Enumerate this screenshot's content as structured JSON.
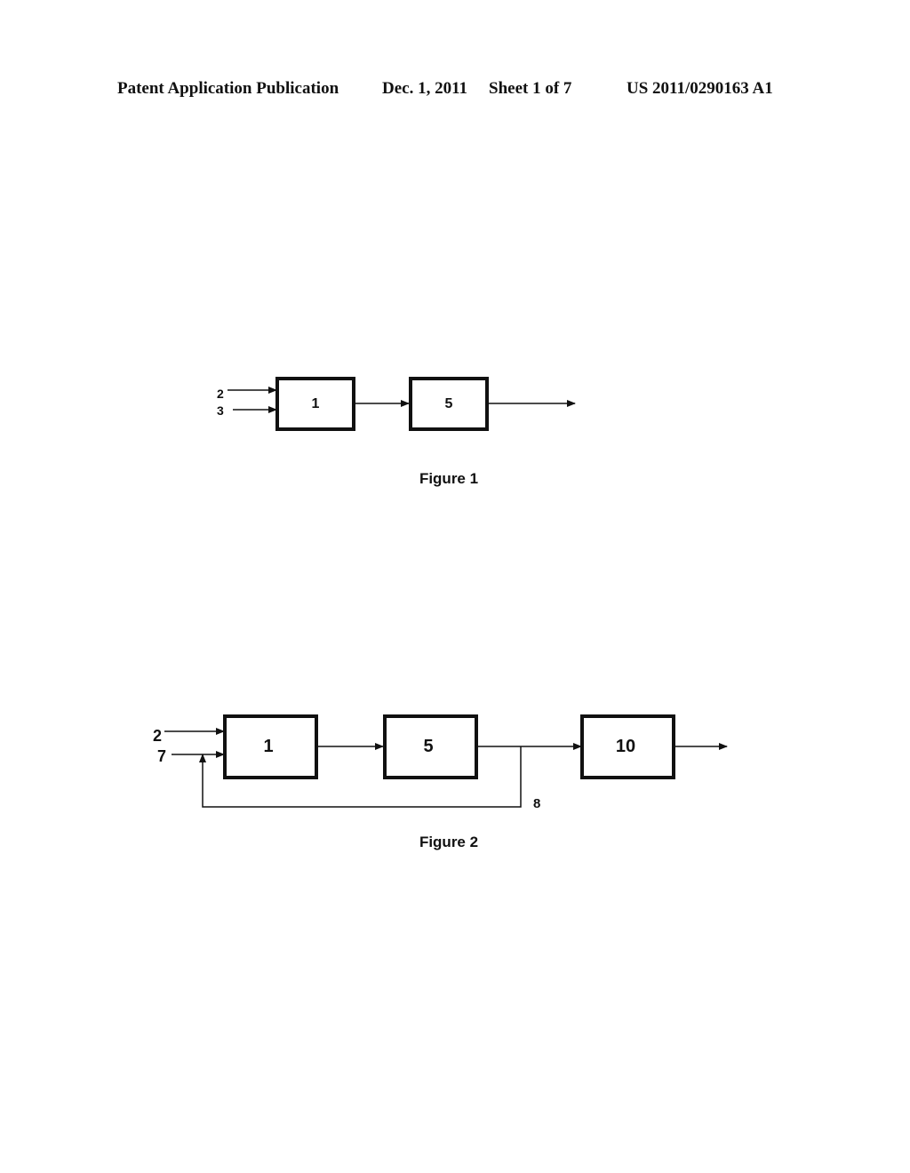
{
  "header": {
    "publication_type": "Patent Application Publication",
    "date": "Dec. 1, 2011",
    "sheet": "Sheet 1 of 7",
    "patent_number": "US 2011/0290163 A1"
  },
  "figure1": {
    "caption": "Figure 1",
    "inputs": [
      "2",
      "3"
    ],
    "blocks": [
      "1",
      "5"
    ]
  },
  "figure2": {
    "caption": "Figure 2",
    "inputs": [
      "2",
      "7"
    ],
    "blocks": [
      "1",
      "5",
      "10"
    ],
    "recycle_label": "8"
  }
}
